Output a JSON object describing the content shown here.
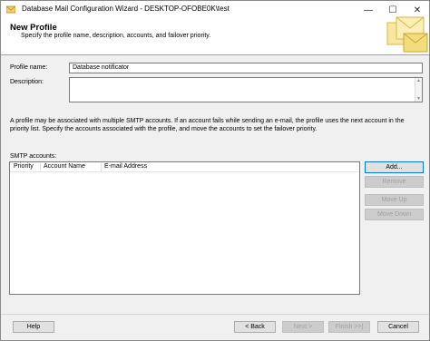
{
  "window": {
    "title": "Database Mail Configuration Wizard - DESKTOP-OFOBE0K\\test",
    "controls": {
      "minimize": "—",
      "maximize": "☐",
      "close": "✕"
    }
  },
  "header": {
    "title": "New Profile",
    "subtitle": "Specify the profile name, description, accounts, and failover priority."
  },
  "form": {
    "profile_name_label": "Profile name:",
    "profile_name_value": "Database notificator",
    "description_label": "Description:",
    "description_value": ""
  },
  "info_text": "A profile may be associated with multiple SMTP accounts. If an account fails while sending an e-mail, the profile uses the next account in the priority list. Specify the accounts associated with the profile, and move the accounts to set the failover priority.",
  "smtp": {
    "label": "SMTP accounts:",
    "columns": [
      "Priority",
      "Account Name",
      "E-mail Address"
    ],
    "rows": []
  },
  "side_buttons": {
    "add": "Add...",
    "remove": "Remove",
    "move_up": "Move Up",
    "move_down": "Move Down"
  },
  "footer_buttons": {
    "help": "Help",
    "back": "< Back",
    "next": "Next >",
    "finish": "Finish >>|",
    "cancel": "Cancel"
  },
  "colors": {
    "focus_border": "#0078d7",
    "disabled_text": "#a0a0a0"
  }
}
